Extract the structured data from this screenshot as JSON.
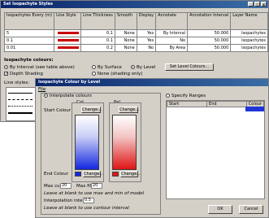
{
  "main_window": {
    "title": "Set Isopachyte Styles",
    "title_buttons": [
      "_",
      "□",
      "x"
    ],
    "table": {
      "headers": [
        "Isopachytes Every (m)",
        "Line Style",
        "Line Thickness",
        "Smooth",
        "Display",
        "Annotate",
        "Annotation Interval",
        "Layer Name"
      ],
      "rows": [
        {
          "every": "5",
          "thickness": "0.1",
          "smooth": "None",
          "display": "Yes",
          "annotate": "By Interval",
          "interval": "50.000",
          "layer": "Isopachytes"
        },
        {
          "every": "0.1",
          "thickness": "0.1",
          "smooth": "None",
          "display": "Yes",
          "annotate": "No",
          "interval": "50.000",
          "layer": "Isopachytes"
        },
        {
          "every": "0.01",
          "thickness": "0.2",
          "smooth": "None",
          "display": "No",
          "annotate": "By Area",
          "interval": "50.000",
          "layer": "Isopachytes"
        }
      ]
    },
    "colours_heading": "Isopachyte colours:",
    "by_interval": "By Interval (see table above)",
    "by_surface": "By Surface",
    "by_level": "By Level",
    "set_level_colours": "Set Level Colours...",
    "depth_shading": "Depth Shading",
    "none_shading": "None (shading only)",
    "line_styles_label": "Line styles:"
  },
  "dialog": {
    "title": "Isopachyte Colour by Level",
    "menu_file": "File",
    "interpolate_colours": "Interpolate colours",
    "specify_ranges": "Specify Ranges",
    "col_label": "Col",
    "pal_label": "Pal",
    "start_colour": "Start Colour",
    "end_colour": "End Colour",
    "change": "Change...",
    "max_cut_label": "Max cut",
    "max_cut_value": "20",
    "max_fill_label": "Max fill",
    "max_fill_value": "20",
    "hint_max": "Leave at blank to use max and min of model",
    "interp_interval_label": "Interpolation interval",
    "interp_interval_value": "0.5",
    "hint_interval": "Leave at blank to use contour interval",
    "ranges_headers": [
      "Start",
      "End",
      "Colour"
    ],
    "ok": "OK",
    "cancel": "Cancel",
    "colors": {
      "start": "#1428e0",
      "end": "#e01414",
      "row_highlight": "#1f35d8"
    }
  }
}
